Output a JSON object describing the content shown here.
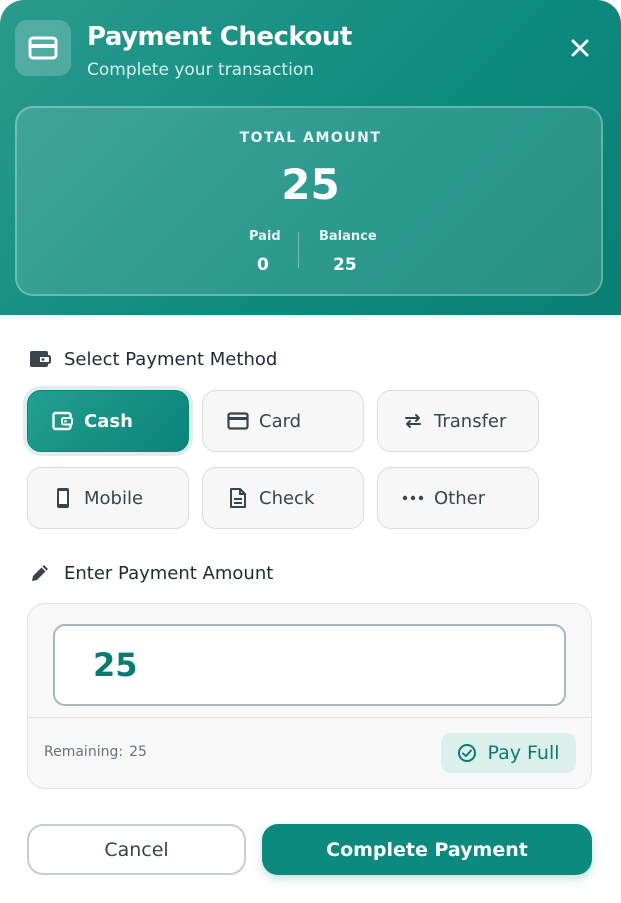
{
  "header": {
    "title": "Payment Checkout",
    "subtitle": "Complete your transaction",
    "icon": "credit-card-icon",
    "close_icon": "close-icon"
  },
  "summary": {
    "total_label": "TOTAL AMOUNT",
    "total_value": "25",
    "paid_label": "Paid",
    "paid_value": "0",
    "balance_label": "Balance",
    "balance_value": "25"
  },
  "methods": {
    "title": "Select Payment Method",
    "icon": "wallet-icon",
    "selected": "Cash",
    "items": [
      {
        "label": "Cash",
        "icon": "wallet-icon"
      },
      {
        "label": "Card",
        "icon": "credit-card-icon"
      },
      {
        "label": "Transfer",
        "icon": "transfer-arrows-icon"
      },
      {
        "label": "Mobile",
        "icon": "mobile-phone-icon"
      },
      {
        "label": "Check",
        "icon": "document-icon"
      },
      {
        "label": "Other",
        "icon": "more-dots-icon"
      }
    ]
  },
  "amount": {
    "title": "Enter Payment Amount",
    "icon": "pencil-icon",
    "value": "25",
    "remaining_label": "Remaining:",
    "remaining_value": "25",
    "pay_full_label": "Pay Full",
    "pay_full_icon": "check-circle-icon"
  },
  "actions": {
    "cancel_label": "Cancel",
    "complete_label": "Complete Payment"
  },
  "colors": {
    "primary": "#0d8a7e",
    "primary_light": "#dbf0ed",
    "text": "#1f2a33"
  }
}
